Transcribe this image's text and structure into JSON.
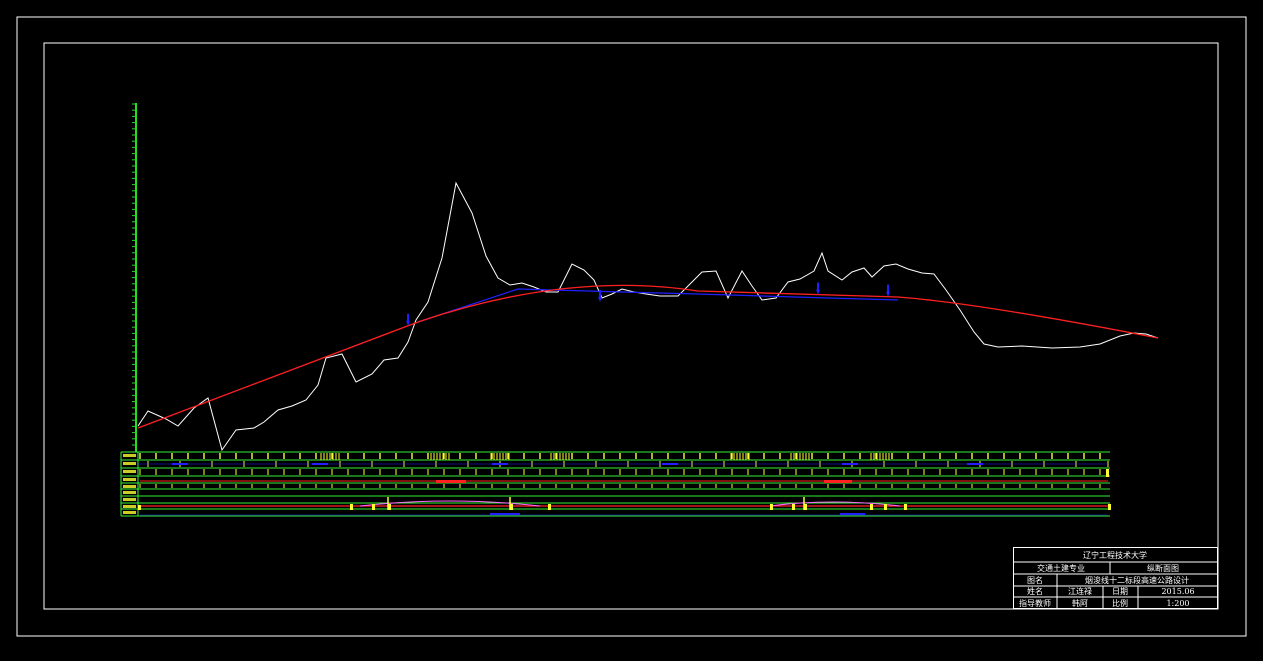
{
  "colors": {
    "background": "#000000",
    "frame": "#ffffff",
    "ground_line": "#ffffff",
    "design_line": "#ff2020",
    "alt_line": "#2020ff",
    "axis": "#22dd22",
    "table_grid": "#33ee33",
    "table_marks": "#ffff33"
  },
  "profile": {
    "ground": [
      [
        0,
        426
      ],
      [
        10,
        411
      ],
      [
        28,
        419
      ],
      [
        40,
        426
      ],
      [
        56,
        408
      ],
      [
        70,
        398
      ],
      [
        84,
        450
      ],
      [
        98,
        430
      ],
      [
        116,
        428
      ],
      [
        126,
        422
      ],
      [
        140,
        410
      ],
      [
        154,
        406
      ],
      [
        168,
        400
      ],
      [
        180,
        385
      ],
      [
        188,
        358
      ],
      [
        204,
        354
      ],
      [
        218,
        382
      ],
      [
        234,
        374
      ],
      [
        246,
        360
      ],
      [
        260,
        358
      ],
      [
        270,
        342
      ],
      [
        278,
        320
      ],
      [
        290,
        302
      ],
      [
        304,
        258
      ],
      [
        318,
        183
      ],
      [
        334,
        213
      ],
      [
        348,
        256
      ],
      [
        360,
        278
      ],
      [
        372,
        285
      ],
      [
        384,
        283
      ],
      [
        396,
        287
      ],
      [
        408,
        292
      ],
      [
        420,
        292
      ],
      [
        434,
        264
      ],
      [
        446,
        270
      ],
      [
        456,
        280
      ],
      [
        464,
        298
      ],
      [
        474,
        294
      ],
      [
        484,
        289
      ],
      [
        496,
        292
      ],
      [
        508,
        294
      ],
      [
        522,
        296
      ],
      [
        540,
        296
      ],
      [
        552,
        284
      ],
      [
        564,
        272
      ],
      [
        578,
        271
      ],
      [
        590,
        298
      ],
      [
        604,
        271
      ],
      [
        614,
        286
      ],
      [
        624,
        300
      ],
      [
        638,
        298
      ],
      [
        650,
        282
      ],
      [
        662,
        279
      ],
      [
        676,
        271
      ],
      [
        684,
        253
      ],
      [
        690,
        271
      ],
      [
        704,
        280
      ],
      [
        714,
        272
      ],
      [
        726,
        268
      ],
      [
        734,
        277
      ],
      [
        746,
        266
      ],
      [
        758,
        264
      ],
      [
        770,
        269
      ],
      [
        784,
        273
      ],
      [
        796,
        274
      ],
      [
        808,
        290
      ],
      [
        822,
        310
      ],
      [
        836,
        332
      ],
      [
        846,
        344
      ],
      [
        860,
        347
      ],
      [
        884,
        346
      ],
      [
        914,
        348
      ],
      [
        942,
        347
      ],
      [
        962,
        344
      ],
      [
        982,
        336
      ],
      [
        996,
        333
      ],
      [
        1008,
        334
      ],
      [
        1020,
        338
      ]
    ],
    "design": [
      [
        0,
        428
      ],
      [
        280,
        322
      ],
      [
        560,
        291
      ],
      [
        760,
        297
      ],
      [
        1020,
        338
      ]
    ],
    "alt": [
      [
        280,
        322
      ],
      [
        380,
        289
      ],
      [
        484,
        292
      ],
      [
        560,
        294
      ],
      [
        690,
        298
      ],
      [
        760,
        300
      ]
    ],
    "markers": [
      270,
      462,
      680,
      750
    ],
    "axis_ticks": 56
  },
  "title_block": {
    "university": "辽宁工程技术大学",
    "major": "交通土建专业",
    "drawing_type": "纵断面图",
    "name_label": "图名",
    "name_value": "烟浚线十二标段高速公路设计",
    "student_label": "姓名",
    "student_value": "江连禄",
    "date_label": "日期",
    "date_value": "2015.06",
    "advisor_label": "指导教师",
    "advisor_value": "韩阿",
    "scale_label": "比例",
    "scale_value": "1:200"
  }
}
